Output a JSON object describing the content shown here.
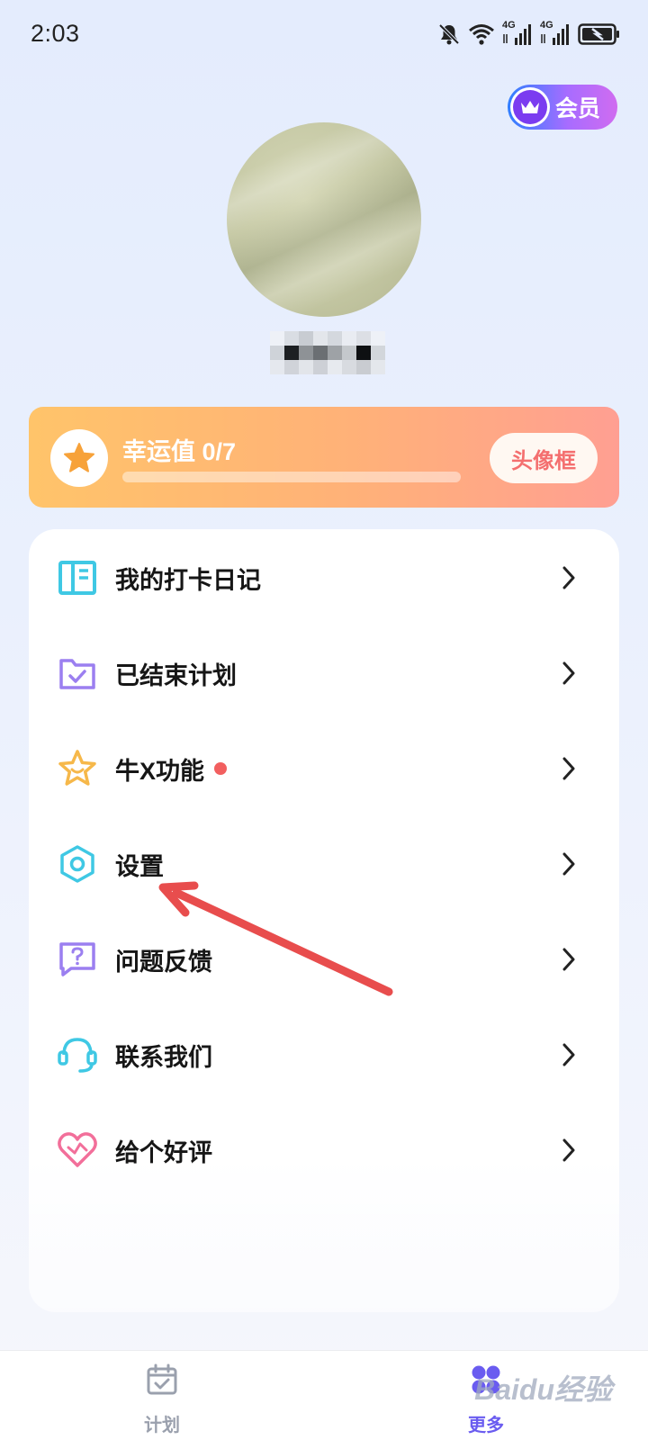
{
  "status_bar": {
    "time": "2:03",
    "network_1": "4G",
    "network_2": "4G"
  },
  "vip": {
    "label": "会员",
    "icon": "crown-icon"
  },
  "profile": {
    "avatar_icon": "avatar",
    "username": ""
  },
  "luck": {
    "title": "幸运值 0/7",
    "progress": 0,
    "button_label": "头像框"
  },
  "menu": {
    "items": [
      {
        "label": "我的打卡日记",
        "icon": "diary-book-icon",
        "color": "#3fc8e4"
      },
      {
        "label": "已结束计划",
        "icon": "folder-check-icon",
        "color": "#9b7ff0"
      },
      {
        "label": "牛X功能",
        "icon": "smile-star-icon",
        "color": "#f6b84a",
        "badge": true
      },
      {
        "label": "设置",
        "icon": "hexagon-gear-icon",
        "color": "#3fc8e4"
      },
      {
        "label": "问题反馈",
        "icon": "question-chat-icon",
        "color": "#9b7ff0"
      },
      {
        "label": "联系我们",
        "icon": "headset-icon",
        "color": "#3fc8e4"
      },
      {
        "label": "给个好评",
        "icon": "heart-icon",
        "color": "#f26f9a"
      }
    ]
  },
  "tabs": [
    {
      "label": "计划",
      "icon": "calendar-check-icon",
      "active": false,
      "color": "#9aa0ad"
    },
    {
      "label": "更多",
      "icon": "clover-icon",
      "active": true,
      "color": "#6a5cf0"
    }
  ],
  "watermark": "Baidu经验",
  "colors": {
    "accent": "#6a5cf0",
    "annotation_arrow": "#e84d4d",
    "luck_gradient_start": "#ffc46a",
    "luck_gradient_end": "#ff9f92"
  }
}
